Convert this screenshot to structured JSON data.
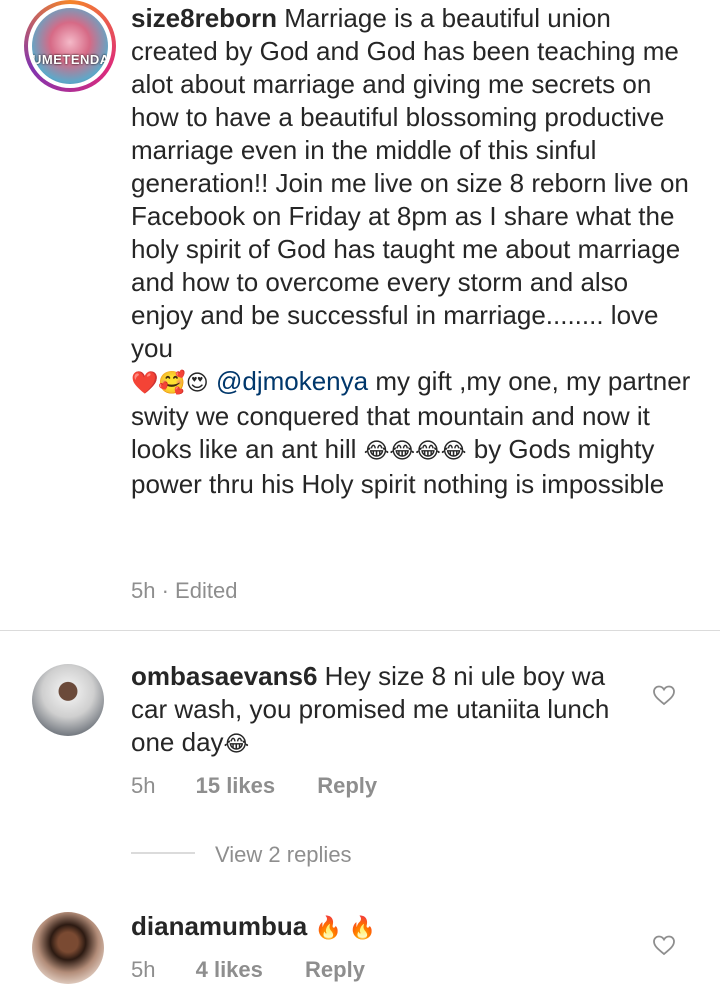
{
  "caption": {
    "username": "size8reborn",
    "text": "Marriage is a beautiful union created by God and God has been teaching me alot about marriage and giving me secrets on how to have a beautiful blossoming productive marriage even in the middle of this sinful generation!! Join me live on size 8 reborn live on Facebook on Friday at 8pm as I share what the holy spirit of God has taught me about marriage and how to overcome every storm and also enjoy and be successful in marriage........ love you",
    "emojis_1": "❤️🥰😍",
    "mention": "@djmokenya",
    "text_2": " my gift ,my one, my partner swity we conquered that mountain and now it looks like an ant hill ",
    "emojis_2": "😂😂😂😂",
    "text_3": " by Gods mighty power thru his Holy spirit nothing is impossible",
    "avatar_label": "UMETENDA",
    "time": "5h",
    "edited": "Edited",
    "meta_sep": " · "
  },
  "comments": [
    {
      "username": "ombasaevans6",
      "text": " Hey size 8 ni ule boy wa car wash, you promised me utaniita lunch one day",
      "emoji": "😂",
      "time": "5h",
      "likes": "15 likes",
      "reply": "Reply",
      "view_replies": "View 2 replies"
    },
    {
      "username": "dianamumbua",
      "text": " ",
      "emoji": "🔥 🔥",
      "time": "5h",
      "likes": "4 likes",
      "reply": "Reply"
    }
  ],
  "colors": {
    "text": "#262626",
    "secondary": "#8e8e8e",
    "mention": "#00376b",
    "divider": "#dbdbdb"
  },
  "icons": [
    "heart-outline-icon",
    "heart-outline-icon"
  ]
}
